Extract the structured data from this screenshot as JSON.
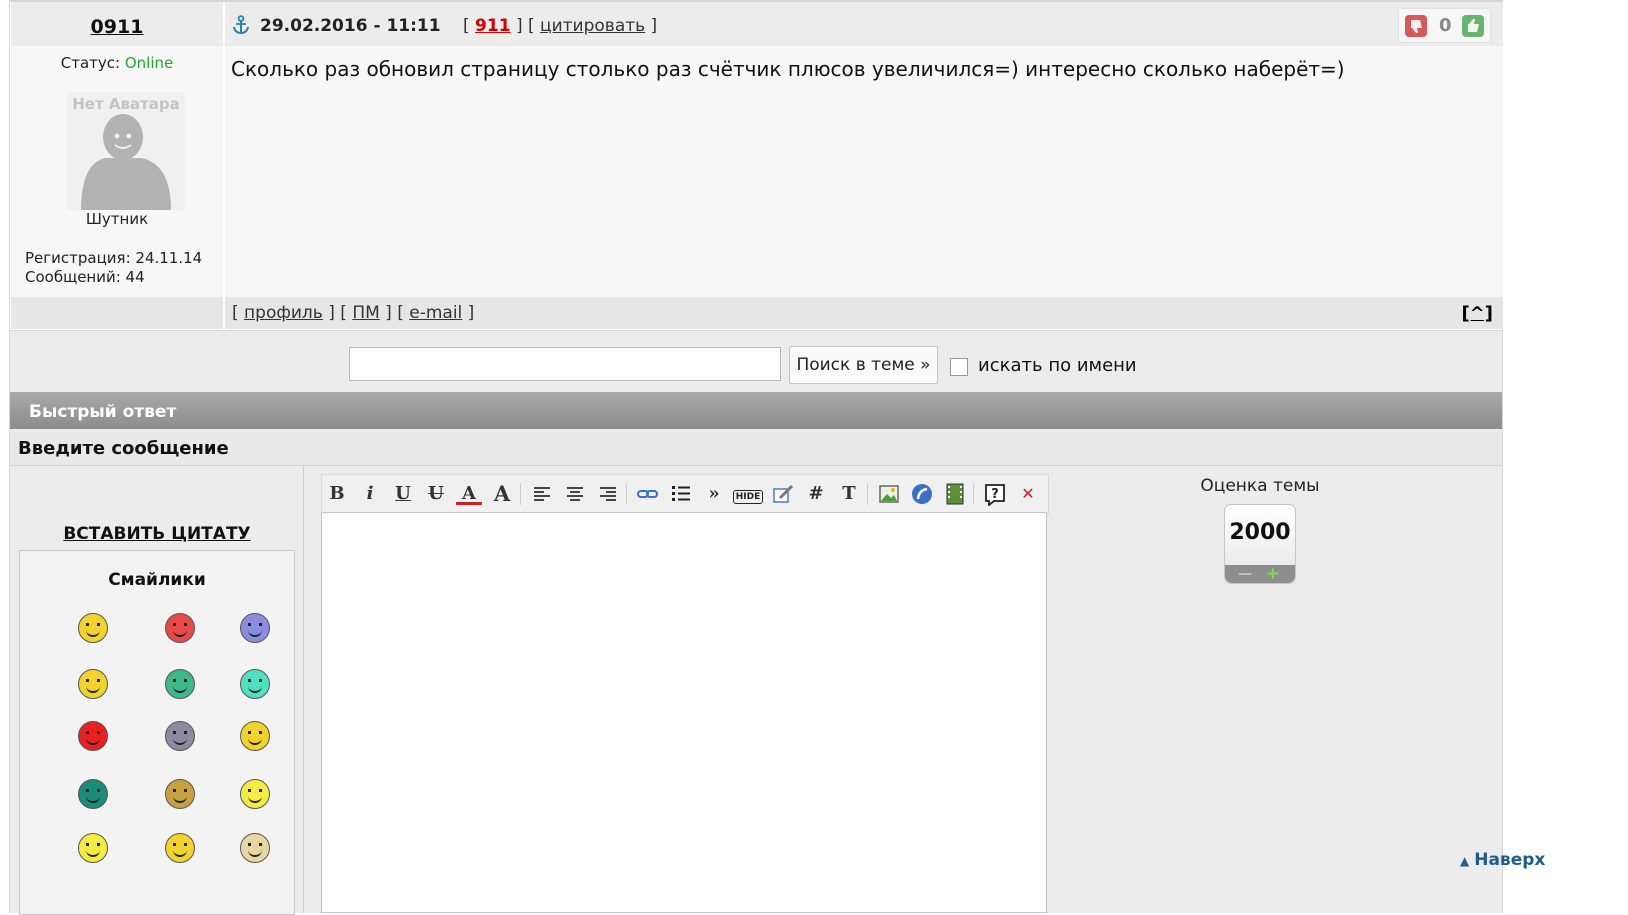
{
  "post": {
    "author": "0911",
    "date": "29.02.2016 - 11:11",
    "number": "911",
    "quote_link": "цитировать",
    "rating": "0",
    "message": "Сколько раз обновил страницу столько раз счётчик плюсов увеличился=) интересно сколько наберёт=)",
    "status_label": "Статус:",
    "status_value": "Online",
    "avatar_text": "Нет Аватара",
    "rank": "Шутник",
    "registration": "Регистрация: 24.11.14",
    "post_count": "Сообщений: 44",
    "footer_links": [
      "профиль",
      "ПМ",
      "e-mail"
    ],
    "to_top": "[^]"
  },
  "search": {
    "button": "Поиск в теме »",
    "checkbox_label": "искать по имени"
  },
  "quick_reply": {
    "title": "Быстрый ответ",
    "enter_message": "Введите сообщение",
    "insert_quote": "ВСТАВИТЬ ЦИТАТУ",
    "smilies_title": "Смайлики",
    "toolbar_hide_label": "HIDE"
  },
  "rating_widget": {
    "title": "Оценка темы",
    "value": "2000",
    "minus": "—",
    "plus": "+"
  },
  "back_to_top": "Наверх",
  "colors": {
    "online": "#25a52b",
    "post_number": "#d40000",
    "link_blue": "#1c5c8e"
  }
}
